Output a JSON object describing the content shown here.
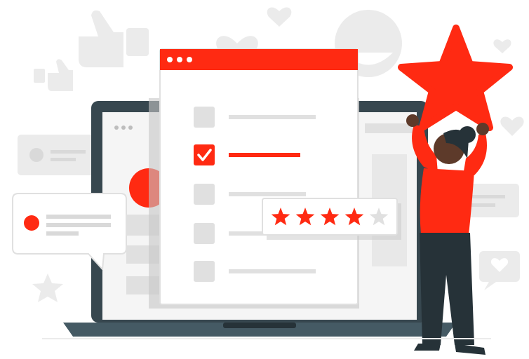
{
  "illustration": {
    "colors": {
      "accent": "#ff2a12",
      "dark": "#37474f",
      "light_gray": "#ebebeb",
      "mid_gray": "#e0e0e0",
      "bar_gray": "#d9d9d9",
      "white": "#ffffff"
    },
    "rating": {
      "filled_stars": 4,
      "total_stars": 5
    },
    "checklist": {
      "items": 5,
      "checked_index": 1
    },
    "icons": [
      "thumbs-up-icon",
      "heart-icon",
      "emoji-face-icon",
      "star-icon",
      "chat-heart-icon",
      "checkbox-checked-icon",
      "window-dots-icon"
    ]
  }
}
